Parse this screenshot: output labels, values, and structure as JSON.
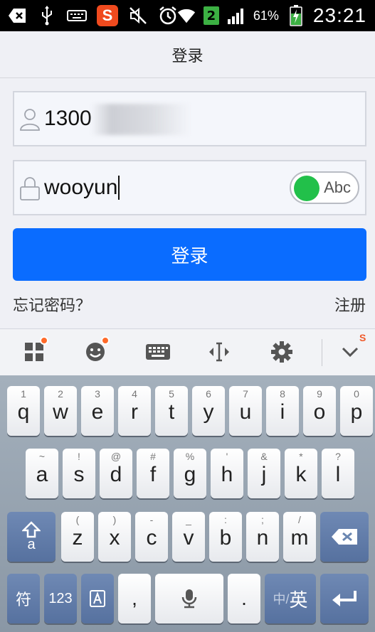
{
  "status_bar": {
    "icons": [
      "notification-icon",
      "usb-icon",
      "keyboard-icon",
      "sogou-icon",
      "mute-icon",
      "alarm-icon",
      "wifi-icon",
      "sim2-icon",
      "signal-icon",
      "battery-icon"
    ],
    "sogou_badge": "S",
    "sim_badge": "2",
    "battery_percent": "61%",
    "time": "23:21"
  },
  "header": {
    "title": "登录"
  },
  "form": {
    "username_value": "1300",
    "password_value": "wooyun",
    "toggle_label": "Abc",
    "login_button": "登录",
    "forgot_password": "忘记密码？",
    "register": "注册"
  },
  "ime_toolbar": {
    "icons": [
      "apps-icon",
      "emoji-icon",
      "keyboard-icon",
      "cursor-icon",
      "settings-icon",
      "collapse-icon"
    ],
    "logo": "S"
  },
  "keyboard": {
    "row1": [
      {
        "pri": "q",
        "sec": "1"
      },
      {
        "pri": "w",
        "sec": "2"
      },
      {
        "pri": "e",
        "sec": "3"
      },
      {
        "pri": "r",
        "sec": "4"
      },
      {
        "pri": "t",
        "sec": "5"
      },
      {
        "pri": "y",
        "sec": "6"
      },
      {
        "pri": "u",
        "sec": "7"
      },
      {
        "pri": "i",
        "sec": "8"
      },
      {
        "pri": "o",
        "sec": "9"
      },
      {
        "pri": "p",
        "sec": "0"
      }
    ],
    "row2": [
      {
        "pri": "a",
        "sec": "~"
      },
      {
        "pri": "s",
        "sec": "!"
      },
      {
        "pri": "d",
        "sec": "@"
      },
      {
        "pri": "f",
        "sec": "#"
      },
      {
        "pri": "g",
        "sec": "%"
      },
      {
        "pri": "h",
        "sec": "'"
      },
      {
        "pri": "j",
        "sec": "&"
      },
      {
        "pri": "k",
        "sec": "*"
      },
      {
        "pri": "l",
        "sec": "?"
      }
    ],
    "row3": [
      {
        "pri": "z",
        "sec": "("
      },
      {
        "pri": "x",
        "sec": ")"
      },
      {
        "pri": "c",
        "sec": "-"
      },
      {
        "pri": "v",
        "sec": "_"
      },
      {
        "pri": "b",
        "sec": ":"
      },
      {
        "pri": "n",
        "sec": ";"
      },
      {
        "pri": "m",
        "sec": "/"
      }
    ],
    "shift_letter": "a",
    "symbol_key": "符",
    "number_key": "123",
    "comma_key": ",",
    "period_key": ".",
    "lang_key_prefix": "中/",
    "lang_key_main": "英"
  }
}
